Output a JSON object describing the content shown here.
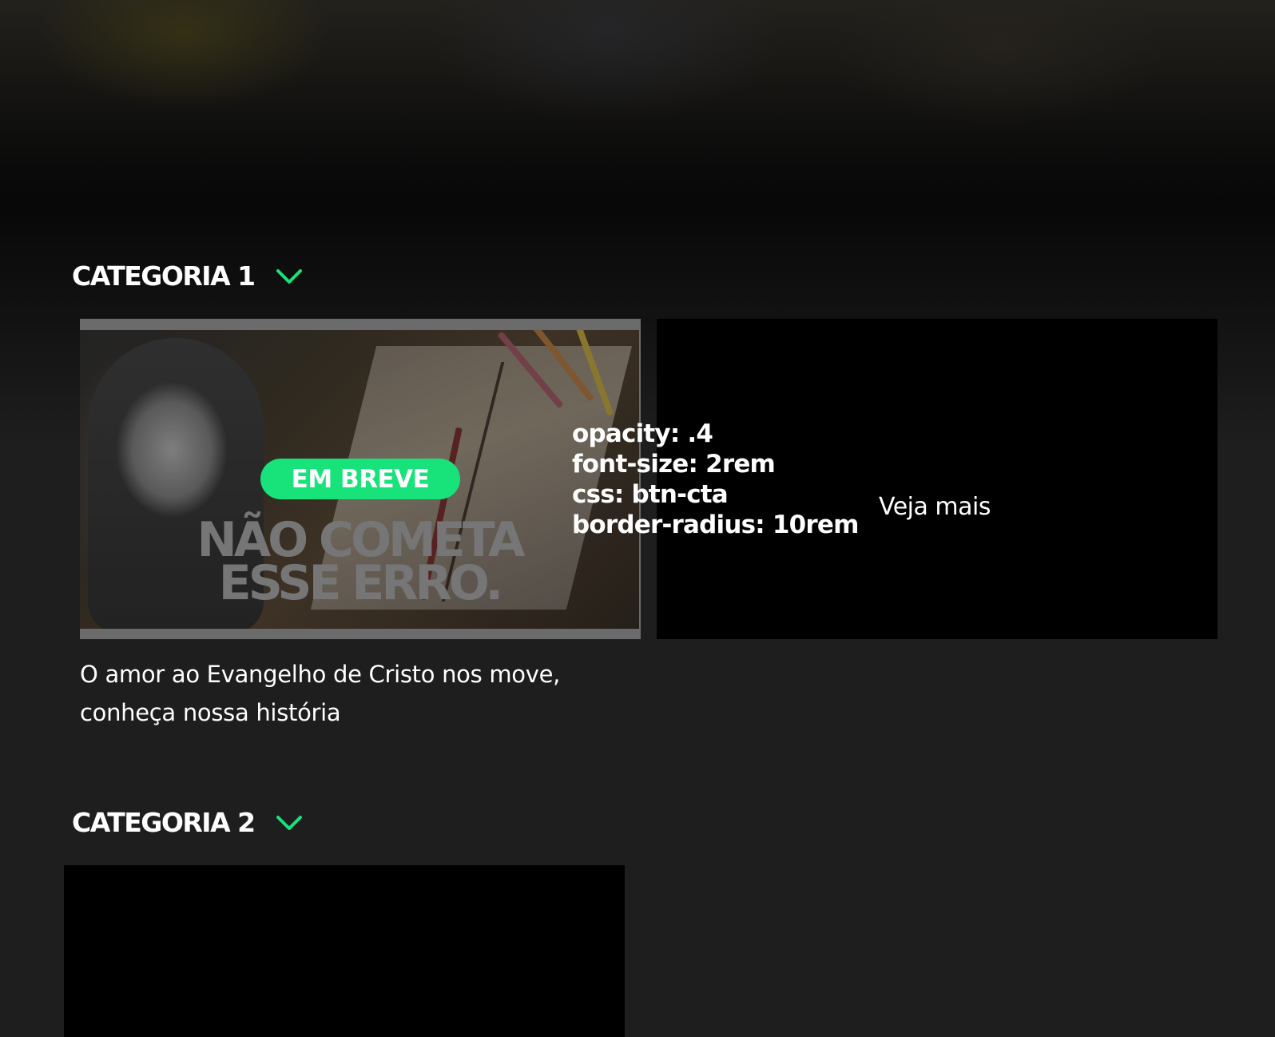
{
  "hero": {},
  "sections": [
    {
      "title": "CATEGORIA 1",
      "chevron_icon": "chevron-down-icon",
      "cards": [
        {
          "badge": "EM BREVE",
          "thumbnail_headline_line1": "NÃO COMETA",
          "thumbnail_headline_line2": "ESSE ERRO.",
          "caption": "O amor ao Evangelho de Cristo nos move, conheça nossa história"
        },
        {
          "notes": [
            "opacity: .4",
            "font-size: 2rem",
            "css: btn-cta",
            "border-radius: 10rem"
          ],
          "link_label": "Veja mais"
        }
      ]
    },
    {
      "title": "CATEGORIA 2",
      "chevron_icon": "chevron-down-icon"
    }
  ],
  "colors": {
    "accent": "#18e27a",
    "background": "#1e1e1e",
    "card": "#000000",
    "text": "#ffffff"
  }
}
